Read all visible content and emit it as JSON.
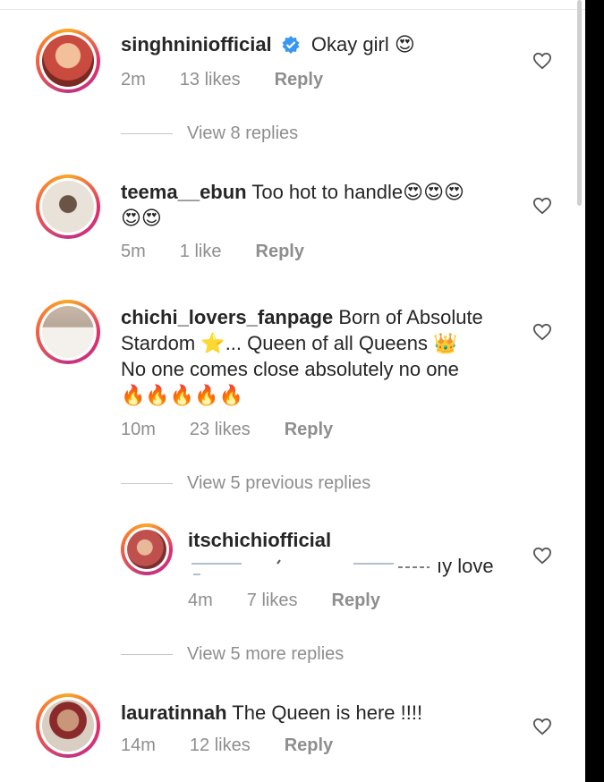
{
  "comments": [
    {
      "username": "singhniniofficial",
      "text": "Okay girl",
      "emoji": "😍",
      "time": "2m",
      "likes": "13 likes",
      "reply": "Reply",
      "avatar_bg": "#c94b3f"
    },
    {
      "username": "teema__ebun",
      "text": "Too hot to handle",
      "emoji_line1": "😍😍😍",
      "emoji_line2": "😍😍",
      "time": "5m",
      "likes": "1 like",
      "reply": "Reply",
      "avatar_bg": "#d9d4cc"
    },
    {
      "username": "chichi_lovers_fanpage",
      "text_line1": "Born of Absolute",
      "text_line2a": "Stardom",
      "star": "⭐",
      "text_line2b": "... Queen of all Queens",
      "crown": "👑",
      "text_line3": "No one comes close absolutely no one",
      "fire": "🔥🔥🔥🔥🔥",
      "time": "10m",
      "likes": "23 likes",
      "reply": "Reply",
      "avatar_bg": "#b8a89a"
    },
    {
      "username": "itschichiofficial",
      "text": "ıy love",
      "time": "4m",
      "likes": "7 likes",
      "reply": "Reply",
      "avatar_bg": "#c0504d"
    },
    {
      "username": "lauratinnah",
      "text": "The Queen is here !!!!",
      "time": "14m",
      "likes": "12 likes",
      "reply": "Reply",
      "avatar_bg": "#8a7a6a"
    }
  ],
  "view_links": {
    "first": "View 8 replies",
    "previous": "View 5 previous replies",
    "more": "View 5 more replies"
  },
  "colors": {
    "text": "#262626",
    "meta": "#8e8e8e",
    "verified": "#3897f0"
  },
  "icons": {
    "like": "heart-outline-icon",
    "verified": "verified-badge-icon"
  }
}
